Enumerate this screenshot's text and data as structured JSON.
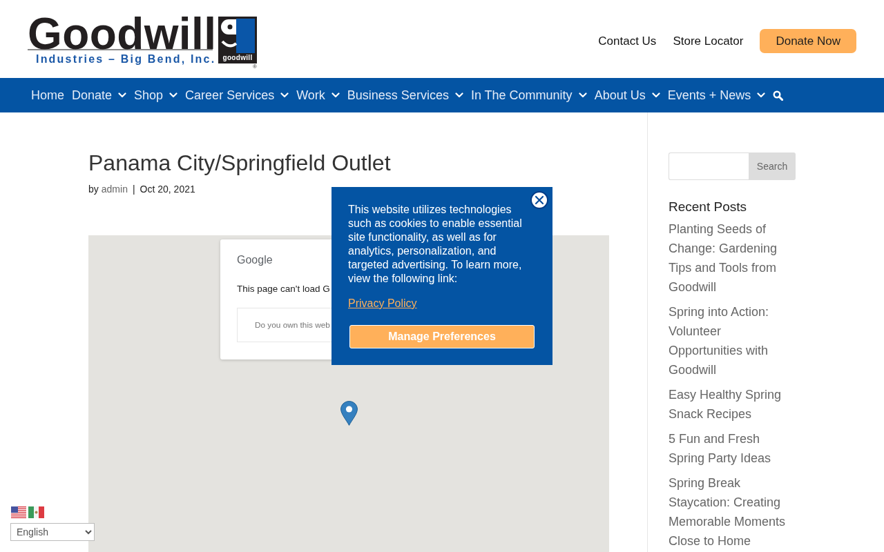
{
  "header": {
    "logo": {
      "wordmark": "Goodwill",
      "tagline": "Industries – Big Bend, Inc.",
      "badge_text": "goodwill",
      "registered_mark": "®"
    },
    "links": [
      {
        "label": "Contact Us"
      },
      {
        "label": "Store Locator"
      }
    ],
    "donate_button": {
      "label": "Donate Now"
    }
  },
  "nav": {
    "items": [
      {
        "label": "Home",
        "has_submenu": false
      },
      {
        "label": "Donate",
        "has_submenu": true
      },
      {
        "label": "Shop",
        "has_submenu": true
      },
      {
        "label": "Career Services",
        "has_submenu": true
      },
      {
        "label": "Work",
        "has_submenu": true
      },
      {
        "label": "Business Services",
        "has_submenu": true
      },
      {
        "label": "In The Community",
        "has_submenu": true
      },
      {
        "label": "About Us",
        "has_submenu": true
      },
      {
        "label": "Events + News",
        "has_submenu": true
      }
    ]
  },
  "post": {
    "title": "Panama City/Springfield Outlet",
    "meta": {
      "by": "by",
      "author": "admin",
      "separator": "|",
      "date": "Oct 20, 2021"
    }
  },
  "map": {
    "error_dialog": {
      "brand": "Google",
      "message": "This page can't load G",
      "notice": "Do you own this web"
    }
  },
  "cookie_banner": {
    "text": "This website utilizes technologies such as cookies to enable essential site functionality, as well as for analytics, personalization, and targeted advertising. To learn more, view the following link:",
    "link": "Privacy Policy",
    "button": "Manage Preferences"
  },
  "sidebar": {
    "search_button": "Search",
    "recent_posts": {
      "title": "Recent Posts",
      "items": [
        "Planting Seeds of Change: Gardening Tips and Tools from Goodwill",
        "Spring into Action: Volunteer Opportunities with Goodwill",
        "Easy Healthy Spring Snack Recipes",
        "5 Fun and Fresh Spring Party Ideas",
        "Spring Break Staycation: Creating Memorable Moments Close to Home"
      ]
    }
  },
  "language": {
    "selected": "English"
  }
}
